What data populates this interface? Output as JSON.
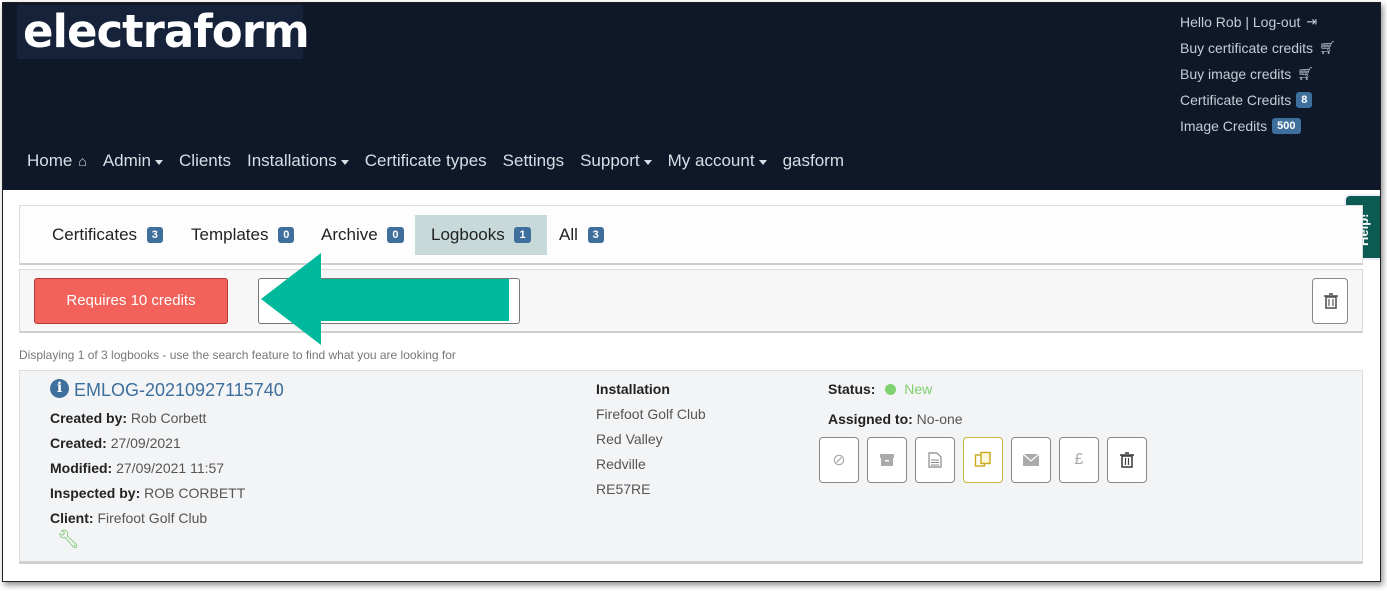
{
  "brand": {
    "logo_text": "electraform"
  },
  "top_links": {
    "greeting": "Hello Rob | Log-out",
    "buy_certificate": "Buy certificate credits",
    "buy_image": "Buy image credits",
    "certificate_credits_label": "Certificate Credits",
    "certificate_credits_count": "8",
    "image_credits_label": "Image Credits",
    "image_credits_count": "500"
  },
  "nav": {
    "home": "Home",
    "admin": "Admin",
    "clients": "Clients",
    "installations": "Installations",
    "certificate_types": "Certificate types",
    "settings": "Settings",
    "support": "Support",
    "my_account": "My account",
    "gasform": "gasform"
  },
  "help": {
    "label": "Help!"
  },
  "tabs": [
    {
      "label": "Certificates",
      "count": "3"
    },
    {
      "label": "Templates",
      "count": "0"
    },
    {
      "label": "Archive",
      "count": "0"
    },
    {
      "label": "Logbooks",
      "count": "1",
      "active": true
    },
    {
      "label": "All",
      "count": "3"
    }
  ],
  "toolbar": {
    "requires_credits_label": "Requires 10 credits"
  },
  "display_text": "Displaying 1 of 3 logbooks - use the search feature to find what you are looking for",
  "logbook": {
    "id": "EMLOG-20210927115740",
    "created_by_label": "Created by:",
    "created_by": "Rob Corbett",
    "created_label": "Created:",
    "created": "27/09/2021",
    "modified_label": "Modified:",
    "modified": "27/09/2021 11:57",
    "inspected_by_label": "Inspected by:",
    "inspected_by": "ROB CORBETT",
    "client_label": "Client:",
    "client": "Firefoot Golf Club",
    "installation_label": "Installation",
    "installation_lines": [
      "Firefoot Golf Club",
      "Red Valley",
      "Redville",
      "RE57RE"
    ],
    "status_label": "Status:",
    "status": "New",
    "assigned_label": "Assigned to:",
    "assigned": "No-one"
  },
  "colors": {
    "header_bg": "#0f1828",
    "danger": "#f2625a",
    "accent_arrow": "#00b89c",
    "status_new": "#7fd06e",
    "badge": "#3f6f9c"
  }
}
